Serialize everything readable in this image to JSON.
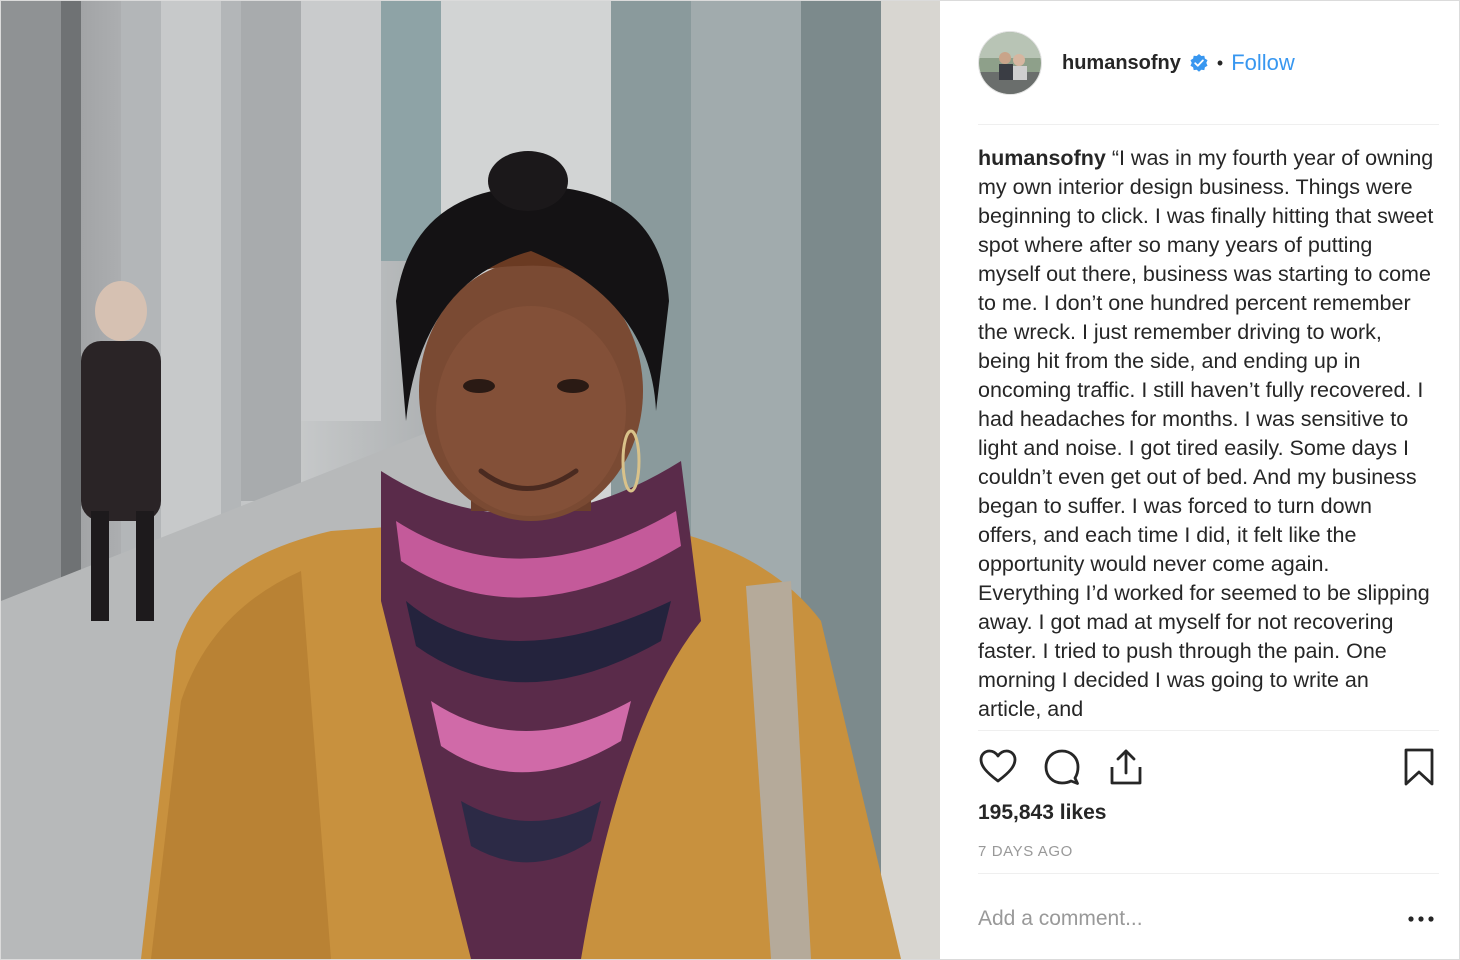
{
  "post": {
    "username": "humansofny",
    "follow_label": "Follow",
    "separator": "•",
    "caption_user": "humansofny",
    "caption_text": "“I was in my fourth year of owning my own interior design business. Things were beginning to click. I was finally hitting that sweet spot where after so many years of putting myself out there, business was starting to come to me. I don’t one hundred percent remember the wreck. I just remember driving to work, being hit from the side, and ending up in oncoming traffic. I still haven’t fully recovered. I had headaches for months. I was sensitive to light and noise. I got tired easily. Some days I couldn’t even get out of bed. And my business began to suffer. I was forced to turn down offers, and each time I did, it felt like the opportunity would never come again. Everything I’d worked for seemed to be slipping away. I got mad at myself for not recovering faster. I tried to push through the pain. One morning I decided I was going to write an article, and",
    "likes": "195,843 likes",
    "timestamp": "7 DAYS AGO",
    "comment_placeholder": "Add a comment..."
  },
  "colors": {
    "accent": "#3897f0",
    "text": "#262626",
    "muted": "#999999",
    "divider": "#efefef"
  },
  "icons": {
    "verified": "verified-badge-icon",
    "like": "heart-icon",
    "comment": "comment-bubble-icon",
    "share": "share-icon",
    "save": "bookmark-icon",
    "more": "more-options-icon"
  }
}
